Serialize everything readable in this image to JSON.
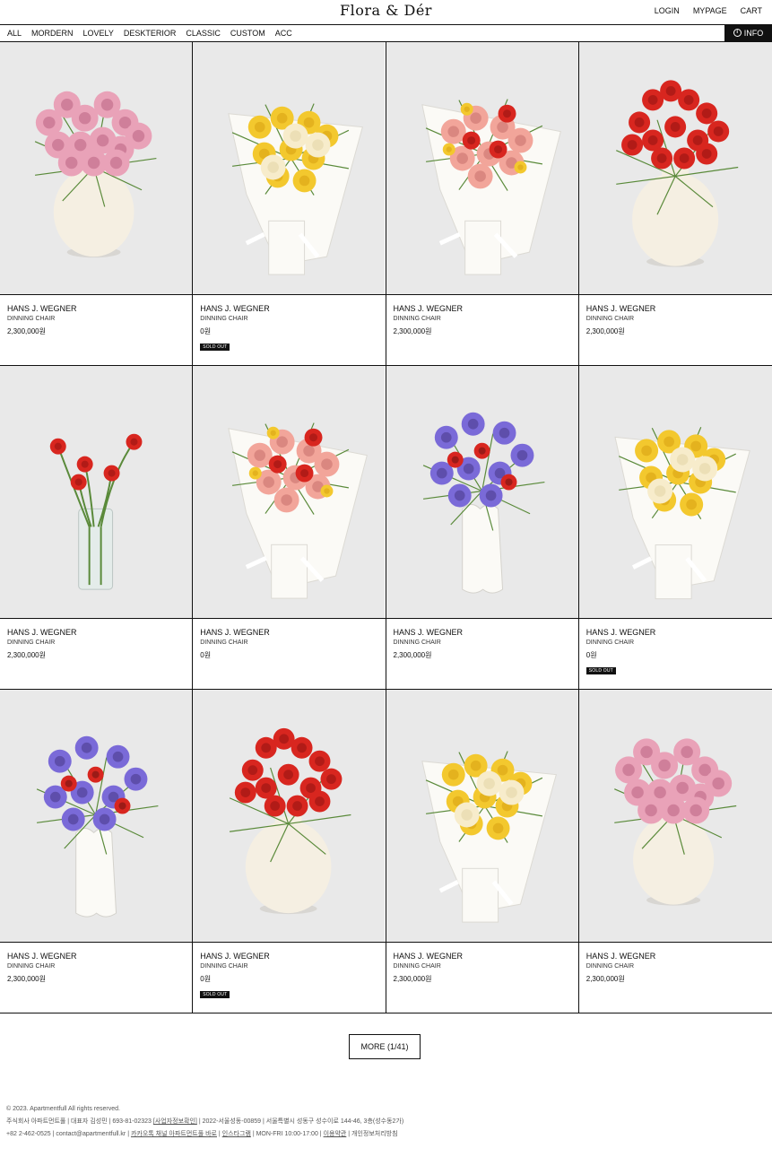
{
  "header": {
    "logo": "Flora & Dér",
    "links": [
      "LOGIN",
      "MYPAGE",
      "CART"
    ]
  },
  "nav": {
    "items": [
      "ALL",
      "MORDERN",
      "LOVELY",
      "DESKTERIOR",
      "CLASSIC",
      "CUSTOM",
      "ACC"
    ],
    "info_label": "INFO"
  },
  "products": [
    {
      "name": "HANS J. WEGNER",
      "sub": "DINNING CHAIR",
      "price": "2,300,000원",
      "sold_out": "",
      "photo": "pink-vase"
    },
    {
      "name": "HANS J. WEGNER",
      "sub": "DINNING CHAIR",
      "price": "0원",
      "sold_out": "SOLD OUT",
      "photo": "yellow-bouquet"
    },
    {
      "name": "HANS J. WEGNER",
      "sub": "DINNING CHAIR",
      "price": "2,300,000원",
      "sold_out": "",
      "photo": "peach-bouquet"
    },
    {
      "name": "HANS J. WEGNER",
      "sub": "DINNING CHAIR",
      "price": "2,300,000원",
      "sold_out": "",
      "photo": "red-tulip-vase"
    },
    {
      "name": "HANS J. WEGNER",
      "sub": "DINNING CHAIR",
      "price": "2,300,000원",
      "sold_out": "",
      "photo": "tulip-glass"
    },
    {
      "name": "HANS J. WEGNER",
      "sub": "DINNING CHAIR",
      "price": "0원",
      "sold_out": "",
      "photo": "peach-bouquet"
    },
    {
      "name": "HANS J. WEGNER",
      "sub": "DINNING CHAIR",
      "price": "2,300,000원",
      "sold_out": "",
      "photo": "anemone-wave"
    },
    {
      "name": "HANS J. WEGNER",
      "sub": "DINNING CHAIR",
      "price": "0원",
      "sold_out": "SOLD OUT",
      "photo": "yellow-bouquet"
    },
    {
      "name": "HANS J. WEGNER",
      "sub": "DINNING CHAIR",
      "price": "2,300,000원",
      "sold_out": "",
      "photo": "anemone-wave"
    },
    {
      "name": "HANS J. WEGNER",
      "sub": "DINNING CHAIR",
      "price": "0원",
      "sold_out": "SOLD OUT",
      "photo": "red-tulip-vase"
    },
    {
      "name": "HANS J. WEGNER",
      "sub": "DINNING CHAIR",
      "price": "2,300,000원",
      "sold_out": "",
      "photo": "yellow-bouquet"
    },
    {
      "name": "HANS J. WEGNER",
      "sub": "DINNING CHAIR",
      "price": "2,300,000원",
      "sold_out": "",
      "photo": "pink-vase"
    }
  ],
  "more_label": "MORE (1/41)",
  "footer": {
    "copyright": "© 2023. Apartmentfull All rights reserved.",
    "line2_a": "주식회사 아파트먼트풀 | 대표자 김성민 | 693-81-02323 ",
    "line2_link": "[사업자정보확인]",
    "line2_b": " | 2022-서울성동-00859 | 서울특별시 성동구 성수이로 144-46, 3층(성수동2가)",
    "line3_a": "+82 2-462-0525  |  contact@apartmentfull.kr | ",
    "line3_link1": "카카오톡 채널 아파트먼트풀 바로",
    "line3_sep1": " | ",
    "line3_link2": "인스타그램",
    "line3_b": "  |  MON-FRI 10:00-17:00 | ",
    "line3_link3": "이용약관",
    "line3_c": " | 개인정보처리방침"
  },
  "colors": {
    "bg_light": "#e9e9e9",
    "red": "#d8261f",
    "pink": "#e9a2b8",
    "yellow": "#f3c82e",
    "cream": "#f5efe2",
    "purple": "#7a6ad8",
    "green": "#5a8a3a",
    "black": "#111111"
  }
}
